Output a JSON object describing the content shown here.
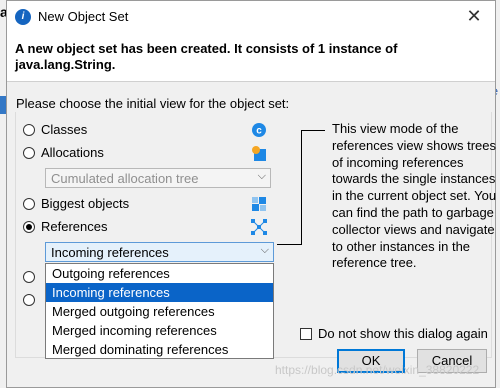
{
  "background": {
    "letter": "a",
    "right_char": "e"
  },
  "dialog": {
    "title": "New Object Set",
    "close_glyph": "✕",
    "header_text": "A new object set has been created. It consists of 1 instance of java.lang.String.",
    "prompt": "Please choose the initial view for the object set:",
    "options": {
      "classes": "Classes",
      "allocations": "Allocations",
      "biggest_objects": "Biggest objects",
      "references": "References"
    },
    "selected_option": "References",
    "allocation_combo": {
      "value": "Cumulated allocation tree",
      "disabled": true
    },
    "references_combo": {
      "value": "Incoming references"
    },
    "dropdown_items": [
      "Outgoing references",
      "Incoming references",
      "Merged outgoing references",
      "Merged incoming references",
      "Merged dominating references"
    ],
    "dropdown_selected": "Incoming references",
    "description": "This view mode of the references view shows trees of incoming references towards the single instances in the current object set. You can find the path to garbage collector views and navigate to other instances in the reference tree.",
    "checkbox_label": "Do not show this dialog again",
    "checkbox_checked": false,
    "ok_label": "OK",
    "cancel_label": "Cancel",
    "watermark": "https://blog.csdn.net/weixin_38820222",
    "icons": {
      "title": "app-icon",
      "classes": "class-c-icon",
      "allocations": "allocation-icon",
      "biggest_objects": "biggest-objects-icon",
      "references": "references-icon"
    },
    "colors": {
      "selection": "#0a64c8",
      "primary_border": "#0078d7",
      "class_icon": "#1e88e5"
    }
  }
}
